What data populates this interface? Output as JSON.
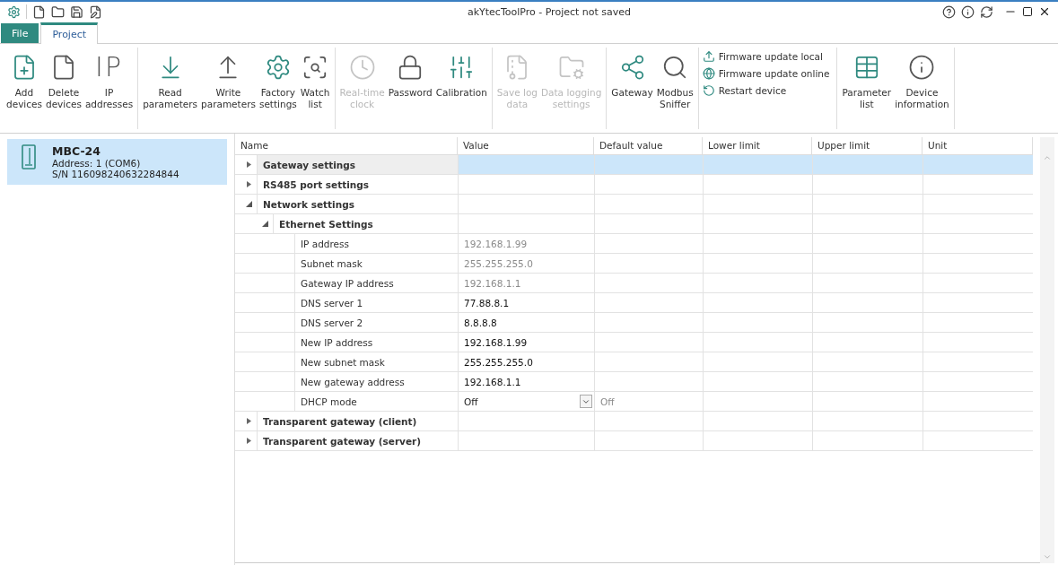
{
  "window": {
    "title": "akYtecToolPro - Project not saved"
  },
  "tabs": [
    {
      "label": "File",
      "kind": "file",
      "selected": false
    },
    {
      "label": "Project",
      "kind": "tab",
      "selected": true
    }
  ],
  "ribbon": [
    {
      "kind": "large",
      "items": [
        {
          "label": "Add\ndevices",
          "disabled": false
        },
        {
          "label": "Delete\ndevices",
          "disabled": false
        },
        {
          "label": "IP\naddresses",
          "glyph": "IP",
          "disabled": false
        }
      ]
    },
    {
      "kind": "large",
      "items": [
        {
          "label": "Read\nparameters",
          "disabled": false
        },
        {
          "label": "Write\nparameters",
          "disabled": false
        },
        {
          "label": "Factory\nsettings",
          "disabled": false
        },
        {
          "label": "Watch\nlist",
          "disabled": false
        }
      ]
    },
    {
      "kind": "large",
      "items": [
        {
          "label": "Real-time\nclock",
          "disabled": true
        },
        {
          "label": "Password",
          "disabled": false
        },
        {
          "label": "Calibration",
          "disabled": false
        }
      ]
    },
    {
      "kind": "large",
      "items": [
        {
          "label": "Save log\ndata",
          "disabled": true
        },
        {
          "label": "Data logging\nsettings",
          "disabled": true
        }
      ]
    },
    {
      "kind": "large",
      "items": [
        {
          "label": "Gateway",
          "disabled": false
        },
        {
          "label": "Modbus\nSniffer",
          "disabled": false
        }
      ]
    },
    {
      "kind": "small",
      "items": [
        {
          "label": "Firmware update local",
          "disabled": false
        },
        {
          "label": "Firmware update online",
          "disabled": false
        },
        {
          "label": "Restart device",
          "disabled": false
        }
      ]
    },
    {
      "kind": "large",
      "items": [
        {
          "label": "Parameter\nlist",
          "disabled": false
        },
        {
          "label": "Device\ninformation",
          "disabled": false
        }
      ]
    }
  ],
  "devices": [
    {
      "name": "MBC-24",
      "address": "Address: 1 (COM6)",
      "serial": "S/N 116098240632284844",
      "selected": true
    }
  ],
  "table": {
    "columns": [
      "Name",
      "Value",
      "Default value",
      "Lower limit",
      "Upper limit",
      "Unit"
    ],
    "rows": [
      {
        "name": "Gateway settings",
        "expanded": false,
        "selected": true
      },
      {
        "name": "RS485 port settings",
        "expanded": false,
        "selected": false
      },
      {
        "name": "Network settings",
        "expanded": true,
        "selected": false,
        "children": [
          {
            "name": "Ethernet Settings",
            "expanded": true,
            "selected": false,
            "children": [
              {
                "name": "IP address",
                "value": "192.168.1.99",
                "readonly": true,
                "kind": "text"
              },
              {
                "name": "Subnet mask",
                "value": "255.255.255.0",
                "readonly": true,
                "kind": "text"
              },
              {
                "name": "Gateway IP address",
                "value": "192.168.1.1",
                "readonly": true,
                "kind": "text"
              },
              {
                "name": "DNS server 1",
                "value": "77.88.8.1",
                "readonly": false,
                "kind": "text"
              },
              {
                "name": "DNS server 2",
                "value": "8.8.8.8",
                "readonly": false,
                "kind": "text"
              },
              {
                "name": "New IP address",
                "value": "192.168.1.99",
                "readonly": false,
                "kind": "text"
              },
              {
                "name": "New subnet mask",
                "value": "255.255.255.0",
                "readonly": false,
                "kind": "text"
              },
              {
                "name": "New gateway address",
                "value": "192.168.1.1",
                "readonly": false,
                "kind": "text"
              },
              {
                "name": "DHCP mode",
                "value": "Off",
                "default": "Off",
                "readonly": false,
                "kind": "dropdown"
              }
            ]
          }
        ]
      },
      {
        "name": "Transparent gateway (client)",
        "expanded": false,
        "selected": false
      },
      {
        "name": "Transparent gateway (server)",
        "expanded": false,
        "selected": false
      }
    ]
  }
}
